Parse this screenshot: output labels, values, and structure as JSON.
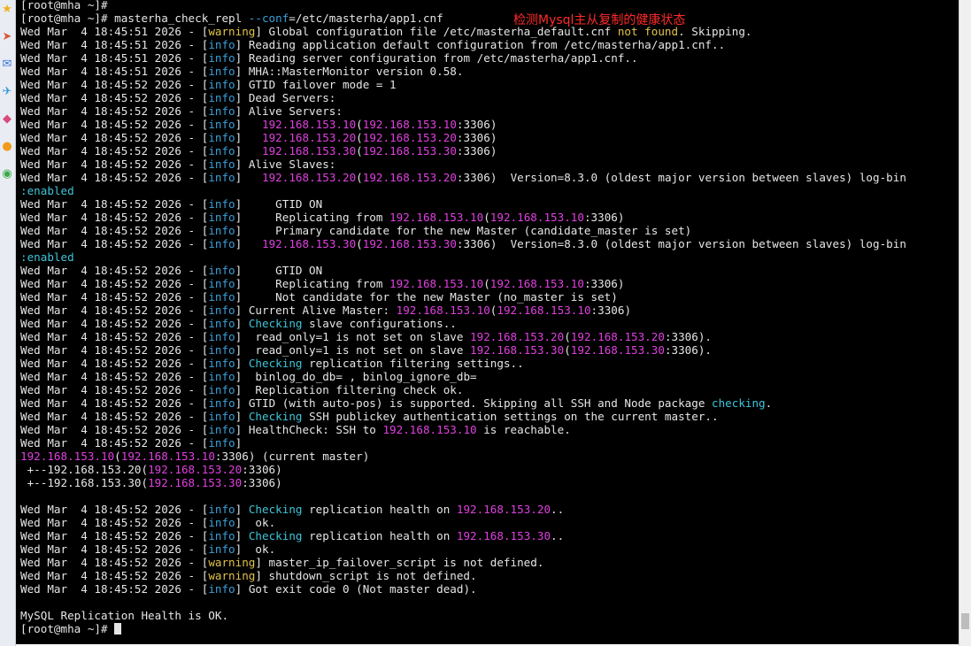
{
  "colors": {
    "default": "#e6e6e6",
    "info": "#3aa0d8",
    "warning": "#e1c24a",
    "magenta": "#e040e0",
    "cyan": "#3fc4d8",
    "annotation": "#ff2a2a"
  },
  "annotation_text": "检测Mysql主从复制的健康状态",
  "sidebar_icons": [
    "star-icon",
    "arrow-icon",
    "mail-icon",
    "send-icon",
    "tag-icon",
    "circle-icon",
    "chrome-icon"
  ],
  "lines": [
    [
      [
        "d",
        "[root@mha ~]#"
      ]
    ],
    [
      [
        "d",
        "[root@mha ~]# masterha_check_repl "
      ],
      [
        "i",
        "--conf"
      ],
      [
        "d",
        "=/etc/masterha/app1.cnf"
      ]
    ],
    [
      [
        "d",
        "Wed Mar  4 18:45:51 2026 - ["
      ],
      [
        "w",
        "warning"
      ],
      [
        "d",
        "] Global configuration file /etc/masterha_default.cnf "
      ],
      [
        "w",
        "not found"
      ],
      [
        "d",
        ". Skipping."
      ]
    ],
    [
      [
        "d",
        "Wed Mar  4 18:45:51 2026 - ["
      ],
      [
        "i",
        "info"
      ],
      [
        "d",
        "] Reading application default configuration from /etc/masterha/app1.cnf.."
      ]
    ],
    [
      [
        "d",
        "Wed Mar  4 18:45:51 2026 - ["
      ],
      [
        "i",
        "info"
      ],
      [
        "d",
        "] Reading server configuration from /etc/masterha/app1.cnf.."
      ]
    ],
    [
      [
        "d",
        "Wed Mar  4 18:45:51 2026 - ["
      ],
      [
        "i",
        "info"
      ],
      [
        "d",
        "] MHA::MasterMonitor version 0.58."
      ]
    ],
    [
      [
        "d",
        "Wed Mar  4 18:45:52 2026 - ["
      ],
      [
        "i",
        "info"
      ],
      [
        "d",
        "] GTID failover mode = 1"
      ]
    ],
    [
      [
        "d",
        "Wed Mar  4 18:45:52 2026 - ["
      ],
      [
        "i",
        "info"
      ],
      [
        "d",
        "] Dead Servers:"
      ]
    ],
    [
      [
        "d",
        "Wed Mar  4 18:45:52 2026 - ["
      ],
      [
        "i",
        "info"
      ],
      [
        "d",
        "] Alive Servers:"
      ]
    ],
    [
      [
        "d",
        "Wed Mar  4 18:45:52 2026 - ["
      ],
      [
        "i",
        "info"
      ],
      [
        "d",
        "]   "
      ],
      [
        "m",
        "192.168.153.10"
      ],
      [
        "d",
        "("
      ],
      [
        "m",
        "192.168.153.10"
      ],
      [
        "d",
        ":3306)"
      ]
    ],
    [
      [
        "d",
        "Wed Mar  4 18:45:52 2026 - ["
      ],
      [
        "i",
        "info"
      ],
      [
        "d",
        "]   "
      ],
      [
        "m",
        "192.168.153.20"
      ],
      [
        "d",
        "("
      ],
      [
        "m",
        "192.168.153.20"
      ],
      [
        "d",
        ":3306)"
      ]
    ],
    [
      [
        "d",
        "Wed Mar  4 18:45:52 2026 - ["
      ],
      [
        "i",
        "info"
      ],
      [
        "d",
        "]   "
      ],
      [
        "m",
        "192.168.153.30"
      ],
      [
        "d",
        "("
      ],
      [
        "m",
        "192.168.153.30"
      ],
      [
        "d",
        ":3306)"
      ]
    ],
    [
      [
        "d",
        "Wed Mar  4 18:45:52 2026 - ["
      ],
      [
        "i",
        "info"
      ],
      [
        "d",
        "] Alive Slaves:"
      ]
    ],
    [
      [
        "d",
        "Wed Mar  4 18:45:52 2026 - ["
      ],
      [
        "i",
        "info"
      ],
      [
        "d",
        "]   "
      ],
      [
        "m",
        "192.168.153.20"
      ],
      [
        "d",
        "("
      ],
      [
        "m",
        "192.168.153.20"
      ],
      [
        "d",
        ":3306)  Version=8.3.0 (oldest major version between slaves) log-bin"
      ]
    ],
    [
      [
        "c",
        ":enabled"
      ]
    ],
    [
      [
        "d",
        "Wed Mar  4 18:45:52 2026 - ["
      ],
      [
        "i",
        "info"
      ],
      [
        "d",
        "]     GTID ON"
      ]
    ],
    [
      [
        "d",
        "Wed Mar  4 18:45:52 2026 - ["
      ],
      [
        "i",
        "info"
      ],
      [
        "d",
        "]     Replicating from "
      ],
      [
        "m",
        "192.168.153.10"
      ],
      [
        "d",
        "("
      ],
      [
        "m",
        "192.168.153.10"
      ],
      [
        "d",
        ":3306)"
      ]
    ],
    [
      [
        "d",
        "Wed Mar  4 18:45:52 2026 - ["
      ],
      [
        "i",
        "info"
      ],
      [
        "d",
        "]     Primary candidate for the new Master (candidate_master is set)"
      ]
    ],
    [
      [
        "d",
        "Wed Mar  4 18:45:52 2026 - ["
      ],
      [
        "i",
        "info"
      ],
      [
        "d",
        "]   "
      ],
      [
        "m",
        "192.168.153.30"
      ],
      [
        "d",
        "("
      ],
      [
        "m",
        "192.168.153.30"
      ],
      [
        "d",
        ":3306)  Version=8.3.0 (oldest major version between slaves) log-bin"
      ]
    ],
    [
      [
        "c",
        ":enabled"
      ]
    ],
    [
      [
        "d",
        "Wed Mar  4 18:45:52 2026 - ["
      ],
      [
        "i",
        "info"
      ],
      [
        "d",
        "]     GTID ON"
      ]
    ],
    [
      [
        "d",
        "Wed Mar  4 18:45:52 2026 - ["
      ],
      [
        "i",
        "info"
      ],
      [
        "d",
        "]     Replicating from "
      ],
      [
        "m",
        "192.168.153.10"
      ],
      [
        "d",
        "("
      ],
      [
        "m",
        "192.168.153.10"
      ],
      [
        "d",
        ":3306)"
      ]
    ],
    [
      [
        "d",
        "Wed Mar  4 18:45:52 2026 - ["
      ],
      [
        "i",
        "info"
      ],
      [
        "d",
        "]     Not candidate for the new Master (no_master is set)"
      ]
    ],
    [
      [
        "d",
        "Wed Mar  4 18:45:52 2026 - ["
      ],
      [
        "i",
        "info"
      ],
      [
        "d",
        "] Current Alive Master: "
      ],
      [
        "m",
        "192.168.153.10"
      ],
      [
        "d",
        "("
      ],
      [
        "m",
        "192.168.153.10"
      ],
      [
        "d",
        ":3306)"
      ]
    ],
    [
      [
        "d",
        "Wed Mar  4 18:45:52 2026 - ["
      ],
      [
        "i",
        "info"
      ],
      [
        "d",
        "] "
      ],
      [
        "c",
        "Checking"
      ],
      [
        "d",
        " slave configurations.."
      ]
    ],
    [
      [
        "d",
        "Wed Mar  4 18:45:52 2026 - ["
      ],
      [
        "i",
        "info"
      ],
      [
        "d",
        "]  read_only=1 is not set on slave "
      ],
      [
        "m",
        "192.168.153.20"
      ],
      [
        "d",
        "("
      ],
      [
        "m",
        "192.168.153.20"
      ],
      [
        "d",
        ":3306)."
      ]
    ],
    [
      [
        "d",
        "Wed Mar  4 18:45:52 2026 - ["
      ],
      [
        "i",
        "info"
      ],
      [
        "d",
        "]  read_only=1 is not set on slave "
      ],
      [
        "m",
        "192.168.153.30"
      ],
      [
        "d",
        "("
      ],
      [
        "m",
        "192.168.153.30"
      ],
      [
        "d",
        ":3306)."
      ]
    ],
    [
      [
        "d",
        "Wed Mar  4 18:45:52 2026 - ["
      ],
      [
        "i",
        "info"
      ],
      [
        "d",
        "] "
      ],
      [
        "c",
        "Checking"
      ],
      [
        "d",
        " replication filtering settings.."
      ]
    ],
    [
      [
        "d",
        "Wed Mar  4 18:45:52 2026 - ["
      ],
      [
        "i",
        "info"
      ],
      [
        "d",
        "]  binlog_do_db= , binlog_ignore_db="
      ]
    ],
    [
      [
        "d",
        "Wed Mar  4 18:45:52 2026 - ["
      ],
      [
        "i",
        "info"
      ],
      [
        "d",
        "]  Replication filtering check ok."
      ]
    ],
    [
      [
        "d",
        "Wed Mar  4 18:45:52 2026 - ["
      ],
      [
        "i",
        "info"
      ],
      [
        "d",
        "] GTID (with auto-pos) is supported. Skipping all SSH and Node package "
      ],
      [
        "c",
        "checking"
      ],
      [
        "d",
        "."
      ]
    ],
    [
      [
        "d",
        "Wed Mar  4 18:45:52 2026 - ["
      ],
      [
        "i",
        "info"
      ],
      [
        "d",
        "] "
      ],
      [
        "c",
        "Checking"
      ],
      [
        "d",
        " SSH publickey authentication settings on the current master.."
      ]
    ],
    [
      [
        "d",
        "Wed Mar  4 18:45:52 2026 - ["
      ],
      [
        "i",
        "info"
      ],
      [
        "d",
        "] HealthCheck: SSH to "
      ],
      [
        "m",
        "192.168.153.10"
      ],
      [
        "d",
        " is reachable."
      ]
    ],
    [
      [
        "d",
        "Wed Mar  4 18:45:52 2026 - ["
      ],
      [
        "i",
        "info"
      ],
      [
        "d",
        "]"
      ]
    ],
    [
      [
        "m",
        "192.168.153.10"
      ],
      [
        "d",
        "("
      ],
      [
        "m",
        "192.168.153.10"
      ],
      [
        "d",
        ":3306) (current master)"
      ]
    ],
    [
      [
        "d",
        " +--192.168.153.20("
      ],
      [
        "m",
        "192.168.153.20"
      ],
      [
        "d",
        ":3306)"
      ]
    ],
    [
      [
        "d",
        " +--192.168.153.30("
      ],
      [
        "m",
        "192.168.153.30"
      ],
      [
        "d",
        ":3306)"
      ]
    ],
    [
      [
        "d",
        ""
      ]
    ],
    [
      [
        "d",
        "Wed Mar  4 18:45:52 2026 - ["
      ],
      [
        "i",
        "info"
      ],
      [
        "d",
        "] "
      ],
      [
        "c",
        "Checking"
      ],
      [
        "d",
        " replication health on "
      ],
      [
        "m",
        "192.168.153.20"
      ],
      [
        "d",
        ".."
      ]
    ],
    [
      [
        "d",
        "Wed Mar  4 18:45:52 2026 - ["
      ],
      [
        "i",
        "info"
      ],
      [
        "d",
        "]  ok."
      ]
    ],
    [
      [
        "d",
        "Wed Mar  4 18:45:52 2026 - ["
      ],
      [
        "i",
        "info"
      ],
      [
        "d",
        "] "
      ],
      [
        "c",
        "Checking"
      ],
      [
        "d",
        " replication health on "
      ],
      [
        "m",
        "192.168.153.30"
      ],
      [
        "d",
        ".."
      ]
    ],
    [
      [
        "d",
        "Wed Mar  4 18:45:52 2026 - ["
      ],
      [
        "i",
        "info"
      ],
      [
        "d",
        "]  ok."
      ]
    ],
    [
      [
        "d",
        "Wed Mar  4 18:45:52 2026 - ["
      ],
      [
        "w",
        "warning"
      ],
      [
        "d",
        "] master_ip_failover_script is not defined."
      ]
    ],
    [
      [
        "d",
        "Wed Mar  4 18:45:52 2026 - ["
      ],
      [
        "w",
        "warning"
      ],
      [
        "d",
        "] shutdown_script is not defined."
      ]
    ],
    [
      [
        "d",
        "Wed Mar  4 18:45:52 2026 - ["
      ],
      [
        "i",
        "info"
      ],
      [
        "d",
        "] Got exit code 0 (Not master dead)."
      ]
    ],
    [
      [
        "d",
        ""
      ]
    ],
    [
      [
        "d",
        "MySQL Replication Health is OK."
      ]
    ],
    [
      [
        "d",
        "[root@mha ~]# "
      ]
    ]
  ]
}
